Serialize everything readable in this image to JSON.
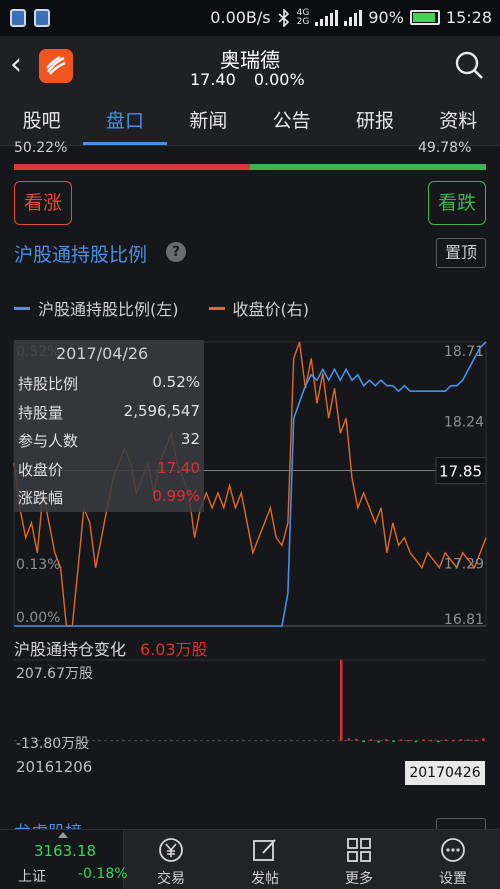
{
  "status": {
    "speed": "0.00B/s",
    "net_top": "4G",
    "net_bottom": "2G",
    "battery": "90%",
    "time": "15:28"
  },
  "header": {
    "title": "奥瑞德",
    "price": "17.40",
    "change": "0.00%"
  },
  "tabs": [
    {
      "label": "股吧"
    },
    {
      "label": "盘口"
    },
    {
      "label": "新闻"
    },
    {
      "label": "公告"
    },
    {
      "label": "研报"
    },
    {
      "label": "资料"
    }
  ],
  "cut_left": "50.22%",
  "cut_right": "49.78%",
  "buttons": {
    "up": "看涨",
    "down": "看跌"
  },
  "section": {
    "title": "沪股通持股比例",
    "help": "?",
    "pin": "置顶"
  },
  "legend": {
    "left": "沪股通持股比例(左)",
    "right": "收盘价(右)"
  },
  "colors": {
    "ratio": "#4a8fe8",
    "close": "#e06a2a",
    "up": "#e0302e",
    "down": "#3fb34f"
  },
  "tooltip": {
    "date": "2017/04/26",
    "rows": [
      {
        "label": "持股比例",
        "value": "0.52%"
      },
      {
        "label": "持股量",
        "value": "2,596,547"
      },
      {
        "label": "参与人数",
        "value": "32"
      },
      {
        "label": "收盘价",
        "value": "17.40"
      },
      {
        "label": "涨跌幅",
        "value": "0.99%"
      }
    ]
  },
  "holding": {
    "label": "沪股通持仓变化",
    "value": "6.03万股"
  },
  "dates": {
    "start": "20161206",
    "end": "20170426"
  },
  "section2_cut": "龙虎股榜",
  "bottom": {
    "index_value": "3163.18",
    "index_name": "上证",
    "index_change": "-0.18%",
    "nav": [
      {
        "label": "交易"
      },
      {
        "label": "发帖"
      },
      {
        "label": "更多"
      },
      {
        "label": "设置"
      }
    ]
  },
  "chart_data": [
    {
      "type": "line",
      "left_axis_ticks": [
        "0.52%",
        "0.13%",
        "0.00%"
      ],
      "right_axis_ticks": [
        "18.71",
        "18.24",
        "17.29",
        "16.81"
      ],
      "crosshair_value": "17.85",
      "ylim_left": [
        0,
        0.52
      ],
      "ylim_right": [
        16.81,
        18.71
      ],
      "series": [
        {
          "name": "沪股通持股比例(左)",
          "axis": "left",
          "values": [
            0,
            0,
            0,
            0,
            0,
            0,
            0,
            0,
            0,
            0,
            0,
            0,
            0,
            0,
            0,
            0,
            0,
            0,
            0,
            0,
            0,
            0,
            0,
            0,
            0,
            0,
            0,
            0,
            0,
            0,
            0,
            0,
            0,
            0,
            0,
            0,
            0,
            0,
            0,
            0,
            0,
            0,
            0,
            0,
            0,
            0,
            0,
            0.06,
            0.38,
            0.41,
            0.44,
            0.46,
            0.45,
            0.47,
            0.45,
            0.47,
            0.45,
            0.47,
            0.45,
            0.46,
            0.44,
            0.45,
            0.44,
            0.45,
            0.44,
            0.44,
            0.43,
            0.44,
            0.43,
            0.43,
            0.43,
            0.43,
            0.43,
            0.43,
            0.43,
            0.44,
            0.44,
            0.45,
            0.47,
            0.49,
            0.51,
            0.52
          ]
        },
        {
          "name": "收盘价(右)",
          "axis": "right",
          "values": [
            17.9,
            17.6,
            17.4,
            17.5,
            17.3,
            17.7,
            17.5,
            17.3,
            17.2,
            16.81,
            16.81,
            17.2,
            17.6,
            17.5,
            17.2,
            17.4,
            17.6,
            17.8,
            17.9,
            18.0,
            17.9,
            17.7,
            17.8,
            17.9,
            17.7,
            17.9,
            18.0,
            18.1,
            17.9,
            17.8,
            17.7,
            17.4,
            17.6,
            17.7,
            17.6,
            17.7,
            17.6,
            17.75,
            17.6,
            17.7,
            17.5,
            17.3,
            17.4,
            17.5,
            17.6,
            17.4,
            17.35,
            17.5,
            18.6,
            18.71,
            18.4,
            18.6,
            18.3,
            18.5,
            18.2,
            18.4,
            18.1,
            18.2,
            17.8,
            17.6,
            17.7,
            17.6,
            17.5,
            17.6,
            17.3,
            17.5,
            17.35,
            17.4,
            17.3,
            17.25,
            17.2,
            17.3,
            17.25,
            17.2,
            17.3,
            17.25,
            17.2,
            17.3,
            17.25,
            17.2,
            17.3,
            17.4
          ]
        }
      ]
    },
    {
      "type": "bar",
      "ytick_labels": [
        "207.67万股",
        "-13.80万股"
      ],
      "ylim": [
        -13.8,
        207.67
      ],
      "values": [
        207.67,
        6,
        5,
        -4,
        3,
        -5,
        4,
        -3,
        3,
        2,
        -3,
        3,
        2,
        -2,
        3,
        2,
        4,
        3,
        2,
        6.03
      ]
    }
  ]
}
